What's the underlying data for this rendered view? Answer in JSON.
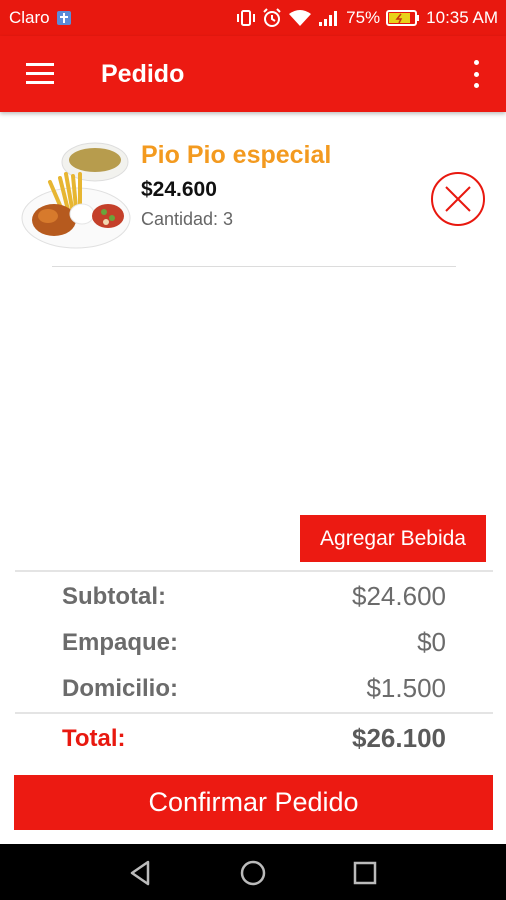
{
  "status_bar": {
    "carrier": "Claro",
    "battery_percent": "75%",
    "time": "10:35 AM"
  },
  "app_bar": {
    "title": "Pedido",
    "menu_icon": "hamburger-menu-icon",
    "overflow_icon": "more-vert-icon"
  },
  "order_items": [
    {
      "name": "Pio Pio especial",
      "price": "$24.600",
      "quantity_text": "Cantidad: 3",
      "image": "food-plate-image",
      "remove_icon": "remove-circle-x-icon"
    }
  ],
  "add_drink_label": "Agregar Bebida",
  "summary": {
    "subtotal_label": "Subtotal:",
    "subtotal_value": "$24.600",
    "packaging_label": "Empaque:",
    "packaging_value": "$0",
    "delivery_label": "Domicilio:",
    "delivery_value": "$1.500",
    "total_label": "Total:",
    "total_value": "$26.100"
  },
  "confirm_label": "Confirmar Pedido",
  "colors": {
    "primary": "#ec1a12",
    "item_name": "#f39a1f",
    "total_label": "#e8180f"
  }
}
